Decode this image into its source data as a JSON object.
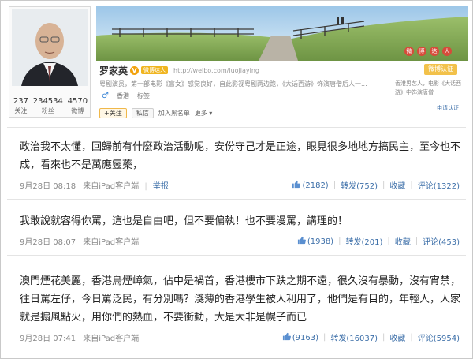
{
  "profile": {
    "name": "罗家英",
    "verified_mark": "V",
    "gold_badge": "微博达人",
    "url": "http://weibo.com/luojiaying",
    "description": "粤剧演员，第一部电影《盲女》感觉良好，自此影视粤剧两边跑，《大话西游》饰演唐僧后人一...",
    "gender_icon": "♂",
    "location": "香港",
    "tags_link": "标签",
    "stats": [
      {
        "value": "237",
        "label": "关注"
      },
      {
        "value": "234534",
        "label": "粉丝"
      },
      {
        "value": "4570",
        "label": "微博"
      }
    ],
    "follow_button": "+关注",
    "message_button": "私信",
    "add_group_link": "加入黑名单",
    "more_link": "更多",
    "verify_badge": "微博认证",
    "side_description": "香港男艺人，电影《大话西游》中饰演唐僧",
    "apply_link": "申请认证",
    "top_icons": [
      "微",
      "博",
      "达",
      "人"
    ]
  },
  "posts": [
    {
      "text": "政治我不太懂，回歸前有什麼政治活動呢，安份守己才是正途，眼見很多地地方搞民主，至今也不成，看來也不是萬應靈藥，",
      "date": "9月28日 08:18",
      "source": "来自iPad客户端",
      "report": "举报",
      "likes": "(2182)",
      "repost": "转发(752)",
      "favorite": "收藏",
      "comment": "评论(1322)"
    },
    {
      "text": "我敢說就容得你罵，這也是自由吧，但不要偏執！也不要漫罵，講理的！",
      "date": "9月28日 08:07",
      "source": "来自iPad客户端",
      "likes": "(1938)",
      "repost": "转发(201)",
      "favorite": "收藏",
      "comment": "评论(453)"
    },
    {
      "text": "澳門煙花美麗，香港烏煙嶂氣，佔中是禍首，香港樓市下跌之期不遠，很久沒有暴動，沒有宵禁，往日罵左仔，今日罵泛民，有分別嗎？淺薄的香港學生被人利用了，他們是有目的，年輕人，人家就是搧風點火，用你們的熱血，不要衝動，大是大非是幌子而已",
      "date": "9月28日 07:41",
      "source": "来自iPad客户端",
      "likes": "(9163)",
      "repost": "转发(16037)",
      "favorite": "收藏",
      "comment": "评论(5954)"
    }
  ],
  "colors": {
    "link": "#3b6ea8",
    "muted": "#888888",
    "badge_gold": "#f2a20c",
    "icon_red": "#d64b3a"
  }
}
